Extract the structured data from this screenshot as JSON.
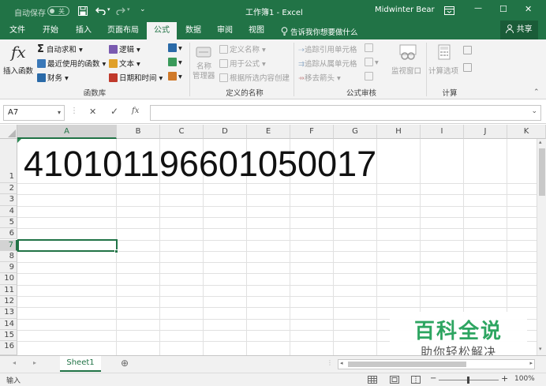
{
  "titlebar": {
    "autosave_label": "自动保存",
    "autosave_state": "关",
    "save_icon": "save-icon",
    "undo_icon": "undo-icon",
    "redo_icon": "redo-icon",
    "customize_icon": "customize-quick-access-icon",
    "title": "工作簿1  -  Excel",
    "user": "Midwinter Bear",
    "ribbon_display_icon": "ribbon-display-options-icon",
    "minimize": "—",
    "maximize": "☐",
    "close": "✕"
  },
  "tabs": [
    "文件",
    "开始",
    "插入",
    "页面布局",
    "公式",
    "数据",
    "审阅",
    "视图"
  ],
  "active_tab": "公式",
  "tell_me": "告诉我你想要做什么",
  "share": "共享",
  "ribbon": {
    "function_library": {
      "insert_function": "插入函数",
      "autosum": "自动求和",
      "recent": "最近使用的函数",
      "financial": "财务",
      "logical": "逻辑",
      "text": "文本",
      "datetime": "日期和时间",
      "label": "函数库"
    },
    "defined_names": {
      "name_manager_1": "名称",
      "name_manager_2": "管理器",
      "define_name": "定义名称",
      "use_in_formula": "用于公式",
      "create_from_selection": "根据所选内容创建",
      "label": "定义的名称"
    },
    "formula_auditing": {
      "trace_precedents": "追踪引用单元格",
      "trace_dependents": "追踪从属单元格",
      "remove_arrows": "移去箭头",
      "watch_window": "监视窗口",
      "label": "公式审核"
    },
    "calculation": {
      "options": "计算选项",
      "label": "计算"
    },
    "colors": {
      "accent": "#217346",
      "ribbon_bg": "#f3f3f3"
    }
  },
  "formula_bar": {
    "name_box": "A7",
    "cancel": "✕",
    "enter": "✓",
    "fx": "fx",
    "value": ""
  },
  "grid": {
    "columns": [
      "A",
      "B",
      "C",
      "D",
      "E",
      "F",
      "G",
      "H",
      "I",
      "J",
      "K"
    ],
    "rows": [
      "1",
      "2",
      "3",
      "4",
      "5",
      "6",
      "7",
      "8",
      "9",
      "10",
      "11",
      "12",
      "13",
      "14",
      "15",
      "16"
    ],
    "selected_cell": "A7",
    "cell_A1": "410101196601050017"
  },
  "sheets": {
    "tab": "Sheet1",
    "add": "⊕"
  },
  "status": {
    "mode": "输入",
    "zoom_minus": "−",
    "zoom_plus": "+",
    "zoom": "100%"
  },
  "watermark": {
    "line1": "百科全说",
    "line2": "助你轻松解决"
  }
}
